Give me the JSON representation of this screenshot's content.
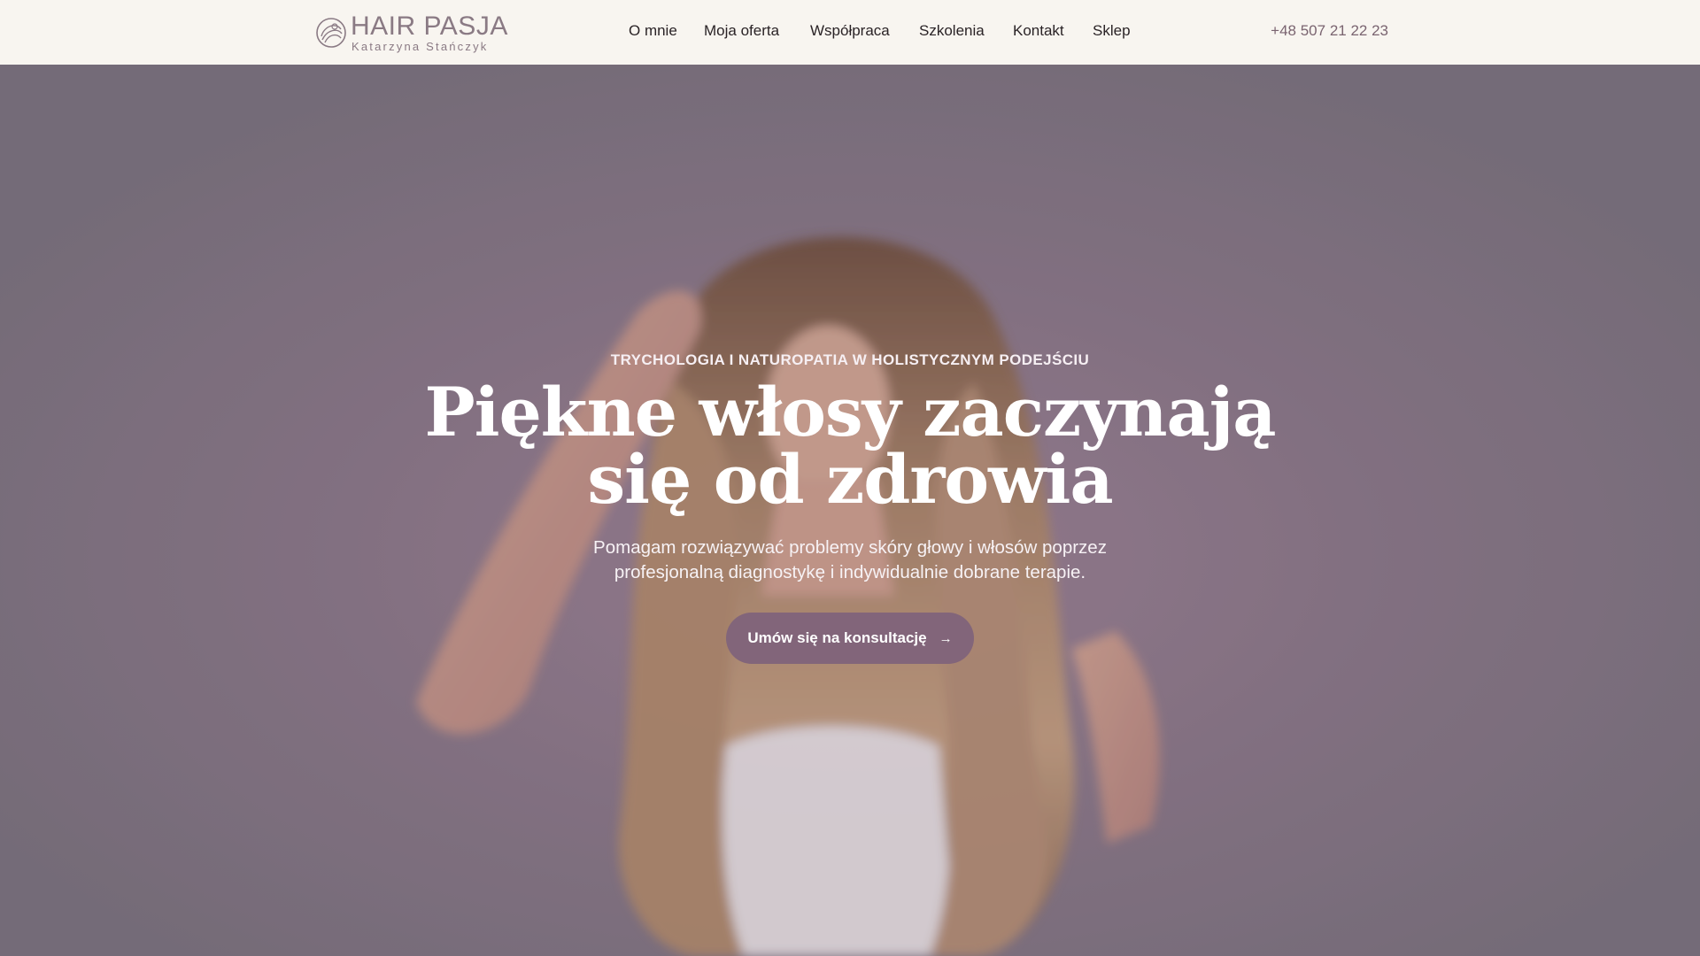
{
  "header": {
    "logo": {
      "title": "HAIR PASJA",
      "subtitle": "Katarzyna Stańczyk"
    },
    "nav": [
      {
        "label": "O mnie"
      },
      {
        "label": "Moja oferta"
      },
      {
        "label": "Współpraca"
      },
      {
        "label": "Szkolenia"
      },
      {
        "label": "Kontakt"
      },
      {
        "label": "Sklep"
      }
    ],
    "phone": "+48 507 21 22 23"
  },
  "hero": {
    "eyebrow": "TRYCHOLOGIA I NATUROPATIA W HOLISTYCZNYM PODEJŚCIU",
    "headline_line1": "Piękne włosy zaczynają",
    "headline_line2": "się od zdrowia",
    "lead_line1": "Pomagam rozwiązywać problemy skóry głowy i włosów poprzez",
    "lead_line2": "profesjonalną diagnostykę i indywidualnie dobrane terapie.",
    "cta_label": "Umów się na konsultację",
    "cta_icon": "arrow-right-icon"
  },
  "colors": {
    "header_bg": "#f8f5f0",
    "brand": "#82657a",
    "phone": "#7a6470",
    "hero_tint": "#7f737f"
  }
}
